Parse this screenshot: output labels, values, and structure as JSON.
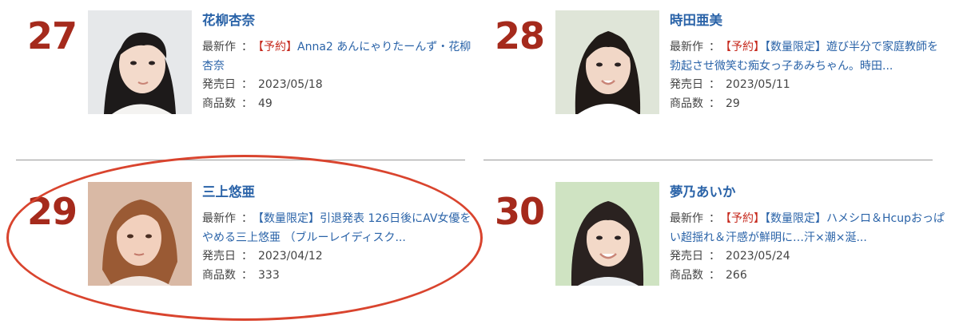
{
  "rankings": [
    {
      "rank": "27",
      "name": "花柳杏奈",
      "latest_label": "最新作",
      "sep": "：",
      "tags": [
        {
          "text": "【予約】",
          "color": "red"
        }
      ],
      "title": "Anna2 あんにゃりたーんず・花柳杏奈",
      "release_label": "発売日",
      "release_date": "2023/05/18",
      "count_label": "商品数",
      "count": "49",
      "photo_colors": {
        "bg": "#e6e8ea",
        "hair": "#1d1a1a",
        "skin": "#f3dacb",
        "cloth": "#f4f3f1"
      }
    },
    {
      "rank": "28",
      "name": "時田亜美",
      "latest_label": "最新作",
      "sep": "：",
      "tags": [
        {
          "text": "【予約】",
          "color": "red"
        },
        {
          "text": "【数量限定】",
          "color": "blue"
        }
      ],
      "title": "遊び半分で家庭教師を勃起させ微笑む痴女っ子あみちゃん。時田...",
      "release_label": "発売日",
      "release_date": "2023/05/11",
      "count_label": "商品数",
      "count": "29",
      "photo_colors": {
        "bg": "#dfe5d8",
        "hair": "#201a17",
        "skin": "#f1d7c7",
        "cloth": "#ffffff"
      }
    },
    {
      "rank": "29",
      "name": "三上悠亜",
      "latest_label": "最新作",
      "sep": "：",
      "tags": [
        {
          "text": "【数量限定】",
          "color": "blue"
        }
      ],
      "title": "引退発表 126日後にAV女優をやめる三上悠亜 （ブルーレイディスク...",
      "release_label": "発売日",
      "release_date": "2023/04/12",
      "count_label": "商品数",
      "count": "333",
      "photo_colors": {
        "bg": "#d9b9a5",
        "hair": "#9a5a34",
        "skin": "#f2d0bd",
        "cloth": "#efe3dc"
      }
    },
    {
      "rank": "30",
      "name": "夢乃あいか",
      "latest_label": "最新作",
      "sep": "：",
      "tags": [
        {
          "text": "【予約】",
          "color": "red"
        },
        {
          "text": "【数量限定】",
          "color": "blue"
        }
      ],
      "title": "ハメシロ＆Hcupおっぱい超揺れ＆汗感が鮮明に…汗×潮×涎...",
      "release_label": "発売日",
      "release_date": "2023/05/24",
      "count_label": "商品数",
      "count": "266",
      "photo_colors": {
        "bg": "#cfe3c2",
        "hair": "#2a2220",
        "skin": "#f3d9c8",
        "cloth": "#e9ecef"
      }
    }
  ],
  "colors": {
    "rank": "#a52a1c",
    "name": "#2a63a8",
    "tag_red": "#c62a1e",
    "tag_blue": "#2a63a8",
    "highlight": "#d9442e"
  }
}
